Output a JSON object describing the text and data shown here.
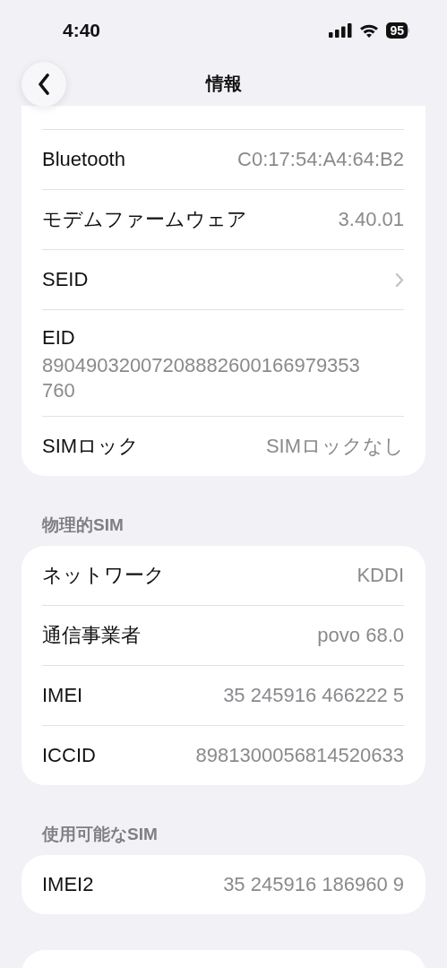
{
  "status_bar": {
    "time": "4:40",
    "battery": "95"
  },
  "nav": {
    "title": "情報"
  },
  "sections": [
    {
      "cut_top": true,
      "rows": [
        {
          "kind": "value",
          "label": "Bluetooth",
          "value": "C0:17:54:A4:64:B2"
        },
        {
          "kind": "value",
          "label": "モデムファームウェア",
          "value": "3.40.01"
        },
        {
          "kind": "link",
          "label": "SEID"
        },
        {
          "kind": "stacked",
          "label": "EID",
          "value": "89049032007208882600166979353760"
        },
        {
          "kind": "value",
          "label": "SIMロック",
          "value": "SIMロックなし"
        }
      ]
    },
    {
      "header": "物理的SIM",
      "cut_top": false,
      "rows": [
        {
          "kind": "value",
          "label": "ネットワーク",
          "value": "KDDI"
        },
        {
          "kind": "value",
          "label": "通信事業者",
          "value": "povo 68.0"
        },
        {
          "kind": "value",
          "label": "IMEI",
          "value": "35 245916 466222 5"
        },
        {
          "kind": "value",
          "label": "ICCID",
          "value": "8981300056814520633"
        }
      ]
    },
    {
      "header": "使用可能なSIM",
      "cut_top": false,
      "rows": [
        {
          "kind": "value",
          "label": "IMEI2",
          "value": "35 245916 186960 9"
        }
      ]
    },
    {
      "cut_top": false
    }
  ]
}
